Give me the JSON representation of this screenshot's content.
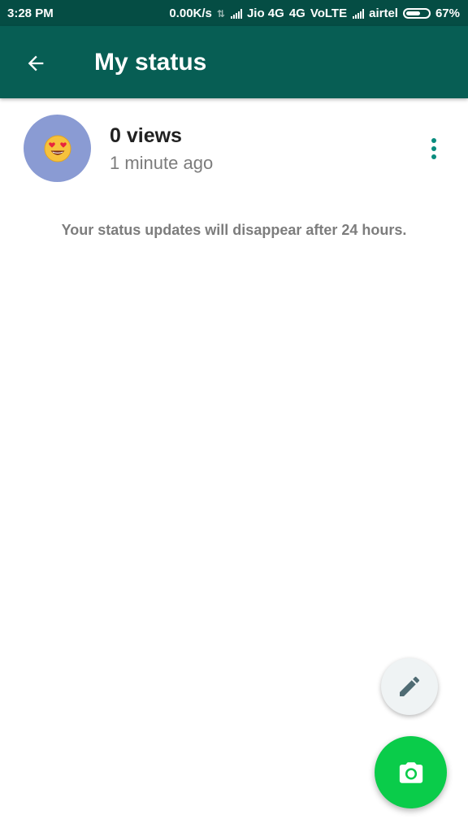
{
  "status_bar": {
    "time": "3:28 PM",
    "net_speed": "0.00K/s",
    "carrier1": "Jio 4G",
    "network_type": "4G",
    "volte": "VoLTE",
    "carrier2": "airtel",
    "battery": "67%",
    "battery_level": 0.67,
    "icons": [
      "data-transfer-icon",
      "signal-strength-icon",
      "signal-strength-icon",
      "battery-icon"
    ]
  },
  "app_bar": {
    "title": "My status",
    "back_icon": "arrow-back-icon"
  },
  "status": {
    "views": "0 views",
    "time_ago": "1 minute ago",
    "avatar_emoji": "😍",
    "menu_icon": "more-vertical-icon"
  },
  "note": "Your status updates will disappear after 24 hours.",
  "fabs": {
    "text_icon": "pencil-icon",
    "camera_icon": "camera-icon"
  },
  "colors": {
    "status_bar": "#054d44",
    "app_bar": "#075e54",
    "accent": "#098c7e",
    "camera_fab": "#0acc4a",
    "pencil_fab": "#eff3f4",
    "avatar_bg": "#8a9bd3"
  }
}
